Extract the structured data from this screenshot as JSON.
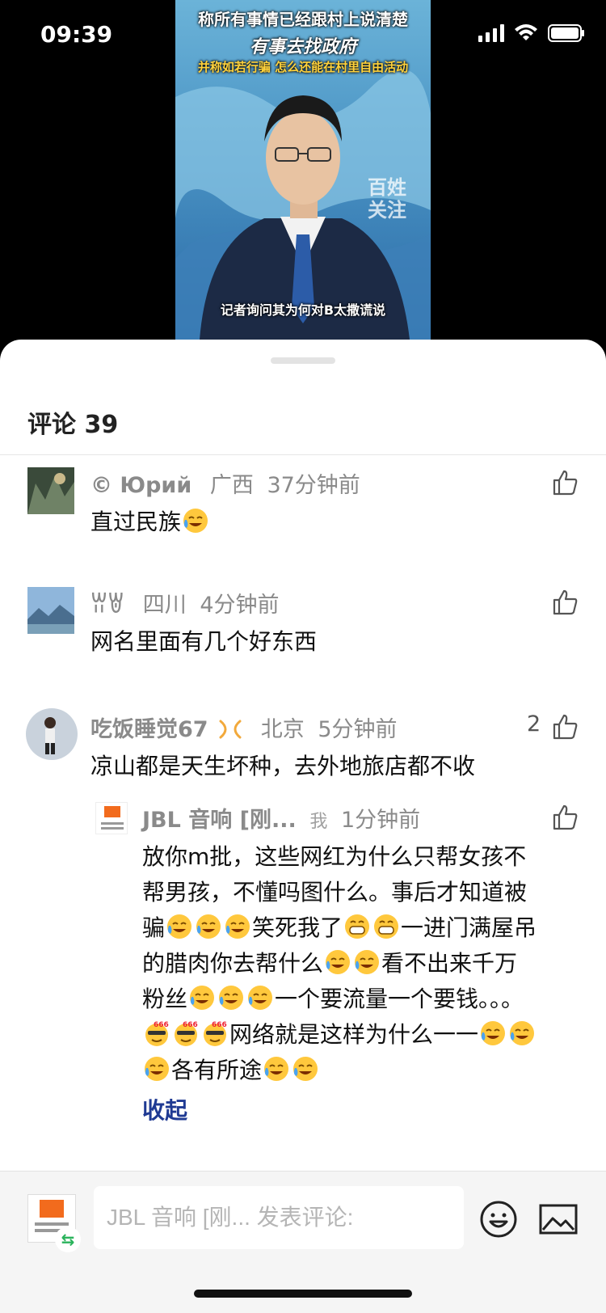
{
  "status_bar": {
    "time": "09:39"
  },
  "video": {
    "headline_1": "称所有事情已经跟村上说清楚",
    "headline_2": "有事去找政府",
    "headline_3": "并称如若行骗 怎么还能在村里自由活动",
    "watermark_1": "百姓",
    "watermark_2": "关注",
    "subtitle": "记者询问其为何对B太撒谎说"
  },
  "comments_panel": {
    "title": "评论 39",
    "comments": [
      {
        "name": "© Юрий",
        "location": "广西",
        "time": "37分钟前",
        "text": "直过民族",
        "emojis": [
          "laugh-cry"
        ]
      },
      {
        "name": "ꀕꇐ",
        "location": "四川",
        "time": "4分钟前",
        "text": "网名里面有几个好东西"
      },
      {
        "name": "吃饭睡觉67",
        "location": "北京",
        "time": "5分钟前",
        "likes": "2",
        "text": "凉山都是天生坏种，去外地旅店都不收",
        "reply": {
          "name": "JBL 音响 [刚...",
          "me_tag": "我",
          "time": "1分钟前",
          "lines": [
            "放你m批，这些网红为什么只帮女孩不",
            "帮男孩，不懂吗图什么。事后才知道被",
            "骗",
            "笑死我了",
            "一进门满屋吊",
            "的腊肉你去帮什么",
            "看不出来千万",
            "粉丝",
            "一个要流量一个要钱。。。",
            "网络就是这样为什么一一",
            "各有所途"
          ],
          "collapse_label": "收起"
        }
      }
    ]
  },
  "input_bar": {
    "placeholder": "JBL 音响 [刚... 发表评论:",
    "swap_icon": "⇆"
  },
  "colors": {
    "accent_link": "#1f3a93",
    "headline_yellow": "#ffd23c"
  }
}
